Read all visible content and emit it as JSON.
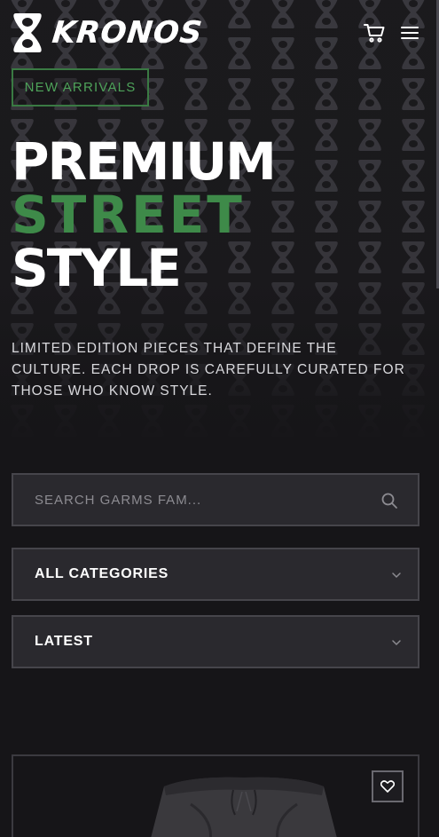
{
  "brand": {
    "name": "KRONOS",
    "logo_icon": "hourglass-logo-icon"
  },
  "header": {
    "cart_icon": "cart-icon",
    "menu_icon": "hamburger-menu-icon"
  },
  "hero": {
    "badge": "NEW ARRIVALS",
    "headline": [
      "PREMIUM",
      "STREET",
      "STYLE"
    ],
    "description": "LIMITED EDITION PIECES THAT DEFINE THE CULTURE. EACH DROP IS CAREFULLY CURATED FOR THOSE WHO KNOW STYLE.",
    "accent_color": "#3e8a49"
  },
  "filters": {
    "search_placeholder": "SEARCH GARMS FAM...",
    "search_icon": "search-icon",
    "category_selected": "ALL CATEGORIES",
    "sort_selected": "LATEST",
    "dropdown_icon": "chevron-down-icon"
  },
  "product_card": {
    "favorite_icon": "heart-icon",
    "image": "black-shorts-product-image"
  }
}
